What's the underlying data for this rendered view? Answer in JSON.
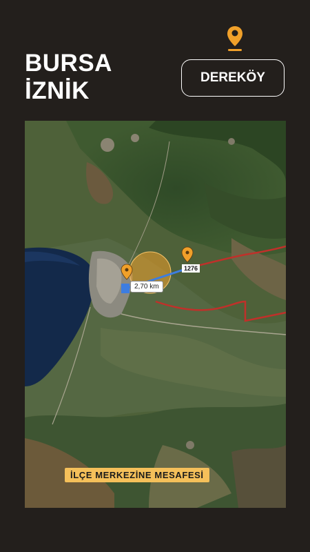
{
  "header": {
    "city_line1": "BURSA",
    "city_line2": "İZNİK",
    "location_pin_icon": "map-pin-icon",
    "place_name": "DEREKÖY"
  },
  "map": {
    "distance_label": "2,70 km",
    "marker_number": "1276",
    "caption": "İLÇE MERKEZİNE MESAFESİ",
    "colors": {
      "route": "#3d7de0",
      "boundary": "#c0302a",
      "pin": "#f0a02a",
      "caption_bg": "#f5c05a",
      "lake": "#13294a"
    }
  }
}
